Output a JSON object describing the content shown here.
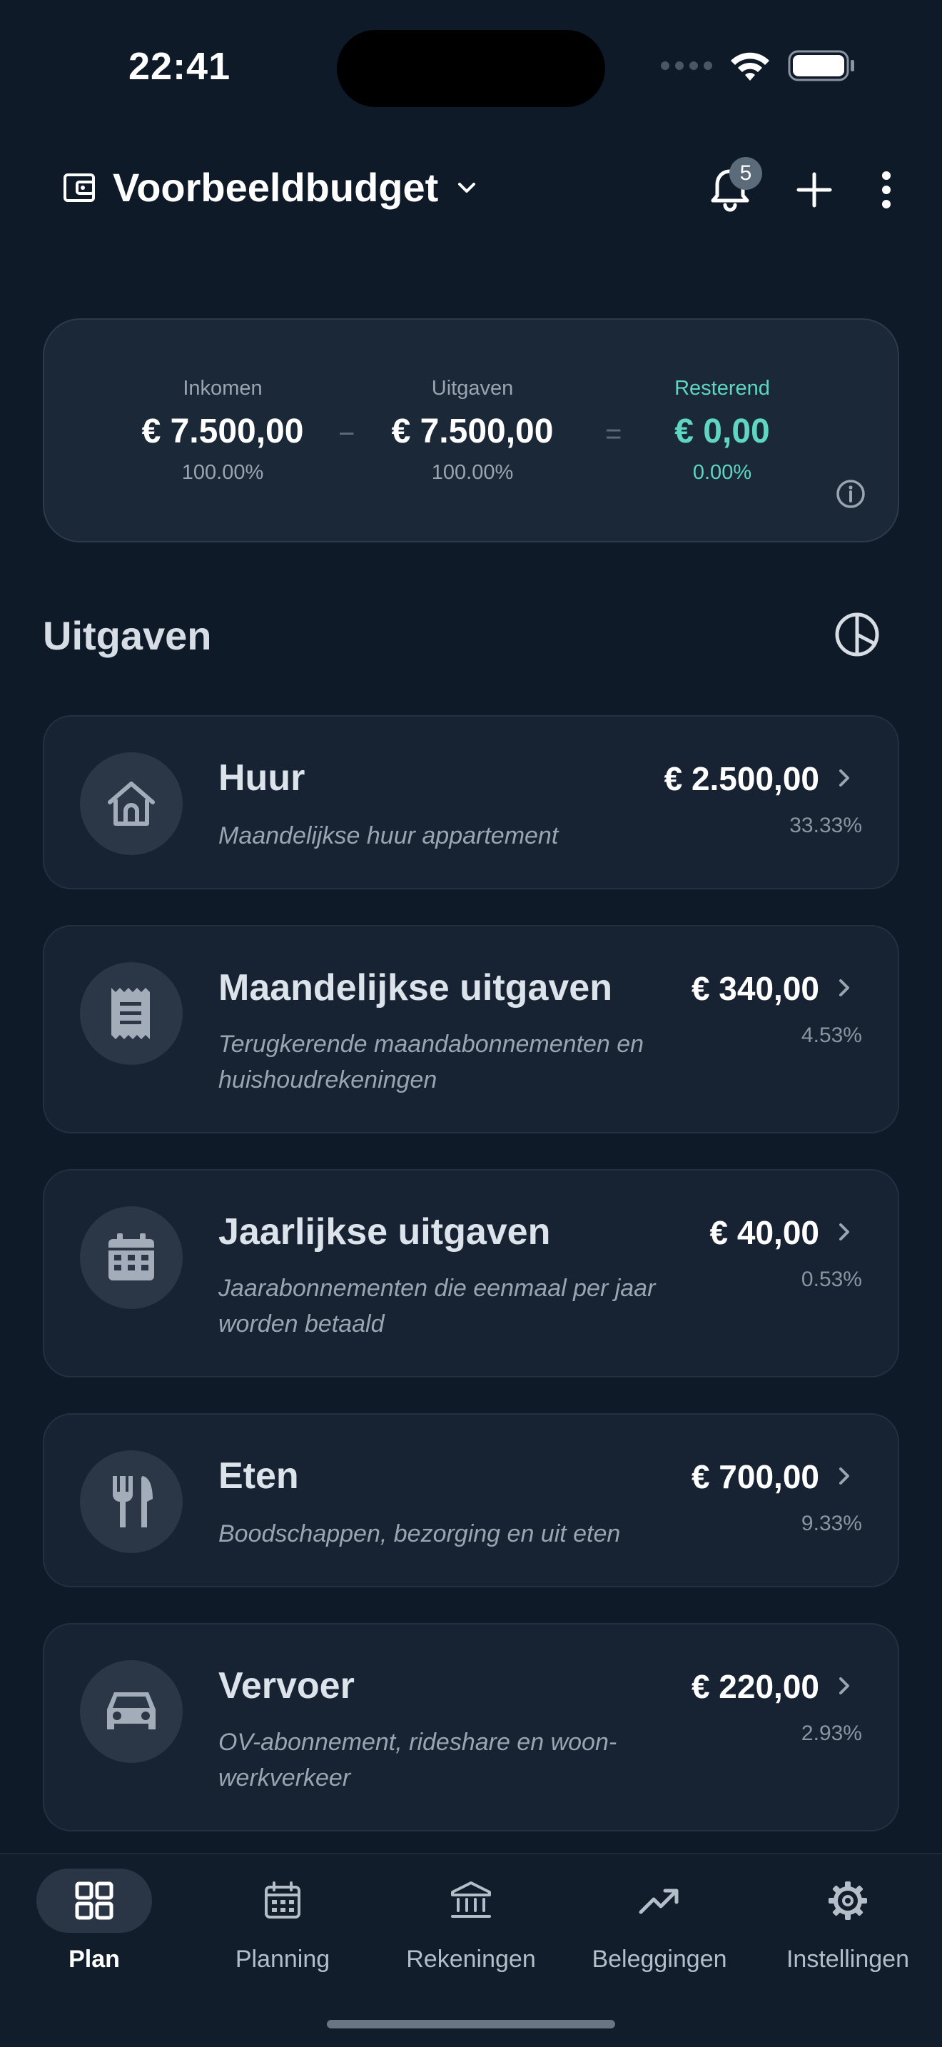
{
  "status_bar": {
    "time": "22:41"
  },
  "header": {
    "budget_name": "Voorbeeldbudget",
    "notification_count": "5"
  },
  "summary": {
    "income_label": "Inkomen",
    "income_amount": "€ 7.500,00",
    "income_pct": "100.00%",
    "minus_sign": "−",
    "expenses_label": "Uitgaven",
    "expenses_amount": "€ 7.500,00",
    "expenses_pct": "100.00%",
    "equals_sign": "=",
    "remaining_label": "Resterend",
    "remaining_amount": "€ 0,00",
    "remaining_pct": "0.00%",
    "accent_color": "#5fd6c2"
  },
  "section": {
    "title": "Uitgaven"
  },
  "categories": [
    {
      "icon": "house-icon",
      "title": "Huur",
      "description": "Maandelijkse huur appartement",
      "amount": "€ 2.500,00",
      "pct": "33.33%"
    },
    {
      "icon": "receipt-icon",
      "title": "Maandelijkse uitgaven",
      "description": "Terugkerende maandabonnementen en huishoudrekeningen",
      "amount": "€ 340,00",
      "pct": "4.53%"
    },
    {
      "icon": "calendar-icon",
      "title": "Jaarlijkse uitgaven",
      "description": "Jaarabonnementen die eenmaal per jaar worden betaald",
      "amount": "€ 40,00",
      "pct": "0.53%"
    },
    {
      "icon": "fork-knife-icon",
      "title": "Eten",
      "description": "Boodschappen, bezorging en uit eten",
      "amount": "€ 700,00",
      "pct": "9.33%"
    },
    {
      "icon": "car-icon",
      "title": "Vervoer",
      "description": "OV-abonnement, rideshare en woon-werkverkeer",
      "amount": "€ 220,00",
      "pct": "2.93%"
    }
  ],
  "nav": {
    "items": [
      {
        "label": "Plan",
        "icon": "grid-icon",
        "active": true
      },
      {
        "label": "Planning",
        "icon": "calendar-icon",
        "active": false
      },
      {
        "label": "Rekeningen",
        "icon": "bank-icon",
        "active": false
      },
      {
        "label": "Beleggingen",
        "icon": "trending-up-icon",
        "active": false
      },
      {
        "label": "Instellingen",
        "icon": "gear-icon",
        "active": false
      }
    ]
  }
}
